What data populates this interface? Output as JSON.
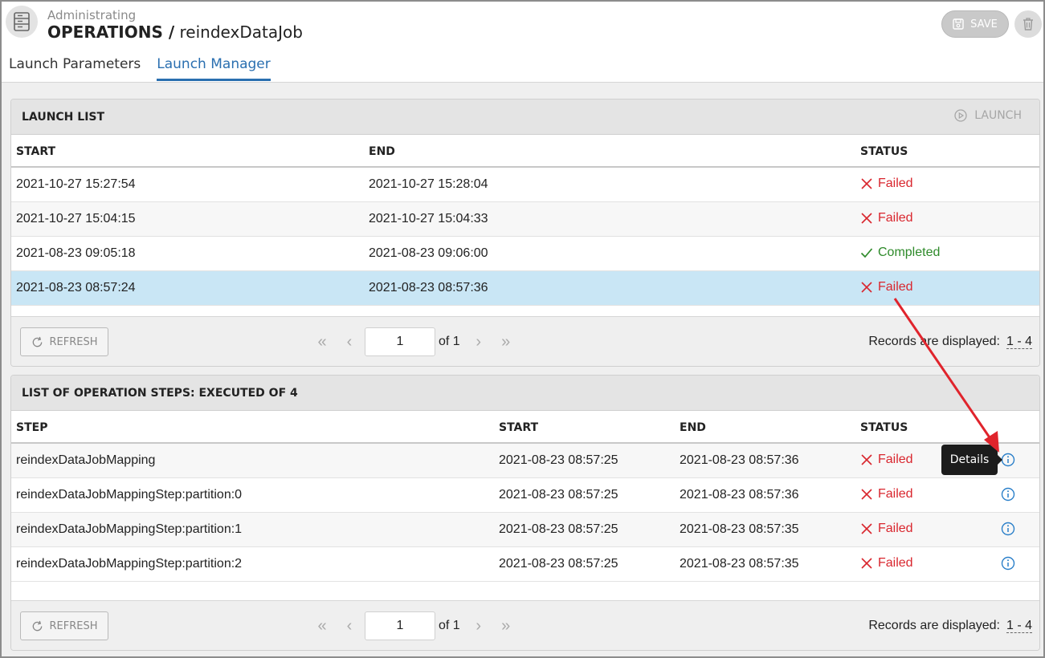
{
  "header": {
    "breadcrumb": "Administrating",
    "title_bold": "OPERATIONS /",
    "title_rest": "reindexDataJob",
    "save_label": "SAVE"
  },
  "tabs": [
    {
      "label": "Launch Parameters",
      "active": false
    },
    {
      "label": "Launch Manager",
      "active": true
    }
  ],
  "launch_list": {
    "title": "LAUNCH LIST",
    "launch_label": "LAUNCH",
    "columns": {
      "start": "START",
      "end": "END",
      "status": "STATUS"
    },
    "rows": [
      {
        "start": "2021-10-27 15:27:54",
        "end": "2021-10-27 15:28:04",
        "status": "Failed"
      },
      {
        "start": "2021-10-27 15:04:15",
        "end": "2021-10-27 15:04:33",
        "status": "Failed"
      },
      {
        "start": "2021-08-23 09:05:18",
        "end": "2021-08-23 09:06:00",
        "status": "Completed"
      },
      {
        "start": "2021-08-23 08:57:24",
        "end": "2021-08-23 08:57:36",
        "status": "Failed"
      }
    ],
    "footer": {
      "refresh_label": "REFRESH",
      "page": "1",
      "of": "of 1",
      "records_label": "Records are displayed:",
      "records_range": "1 - 4"
    }
  },
  "steps_list": {
    "title": "LIST OF OPERATION STEPS: EXECUTED OF 4",
    "columns": {
      "step": "STEP",
      "start": "START",
      "end": "END",
      "status": "STATUS"
    },
    "rows": [
      {
        "step": "reindexDataJobMapping",
        "start": "2021-08-23 08:57:25",
        "end": "2021-08-23 08:57:36",
        "status": "Failed"
      },
      {
        "step": "reindexDataJobMappingStep:partition:0",
        "start": "2021-08-23 08:57:25",
        "end": "2021-08-23 08:57:36",
        "status": "Failed"
      },
      {
        "step": "reindexDataJobMappingStep:partition:1",
        "start": "2021-08-23 08:57:25",
        "end": "2021-08-23 08:57:35",
        "status": "Failed"
      },
      {
        "step": "reindexDataJobMappingStep:partition:2",
        "start": "2021-08-23 08:57:25",
        "end": "2021-08-23 08:57:35",
        "status": "Failed"
      }
    ],
    "footer": {
      "refresh_label": "REFRESH",
      "page": "1",
      "of": "of 1",
      "records_label": "Records are displayed:",
      "records_range": "1 - 4"
    },
    "tooltip": "Details"
  },
  "colors": {
    "accent": "#2a6fb0",
    "failed": "#d9262e",
    "completed": "#2e8a2a",
    "selected_row": "#c9e6f5",
    "annotation_arrow": "#e0242c"
  }
}
